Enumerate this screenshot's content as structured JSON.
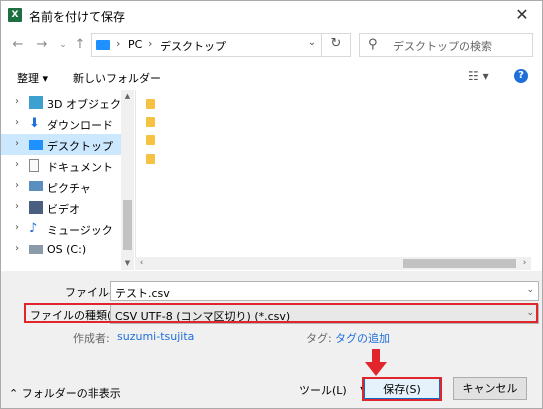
{
  "window": {
    "title": "名前を付けて保存",
    "app_icon": "X"
  },
  "address": {
    "crumbs": [
      "PC",
      "デスクトップ"
    ],
    "search_placeholder": "デスクトップの検索"
  },
  "toolbar": {
    "organize": "整理 ▾",
    "new_folder": "新しいフォルダー"
  },
  "nav": [
    {
      "label": "3D オブジェクト",
      "icon": "3d-objects-icon"
    },
    {
      "label": "ダウンロード",
      "icon": "download-icon"
    },
    {
      "label": "デスクトップ",
      "icon": "desktop-icon",
      "selected": true
    },
    {
      "label": "ドキュメント",
      "icon": "document-icon"
    },
    {
      "label": "ピクチャ",
      "icon": "pictures-icon"
    },
    {
      "label": "ビデオ",
      "icon": "video-icon"
    },
    {
      "label": "ミュージック",
      "icon": "music-icon"
    },
    {
      "label": "OS (C:)",
      "icon": "drive-icon"
    }
  ],
  "form": {
    "filename_label": "ファイル名(N):",
    "filename_value": "テスト.csv",
    "filetype_label": "ファイルの種類(T):",
    "filetype_value": "CSV UTF-8 (コンマ区切り) (*.csv)",
    "author_label": "作成者:",
    "author_value": "suzumi-tsujita",
    "tags_label": "タグ:",
    "tags_value": "タグの追加"
  },
  "footer": {
    "hide_folders": "フォルダーの非表示",
    "tools": "ツール(L)",
    "save": "保存(S)",
    "cancel": "キャンセル"
  },
  "colors": {
    "highlight_red": "#e0262c",
    "accent_blue": "#1e6fd9"
  }
}
